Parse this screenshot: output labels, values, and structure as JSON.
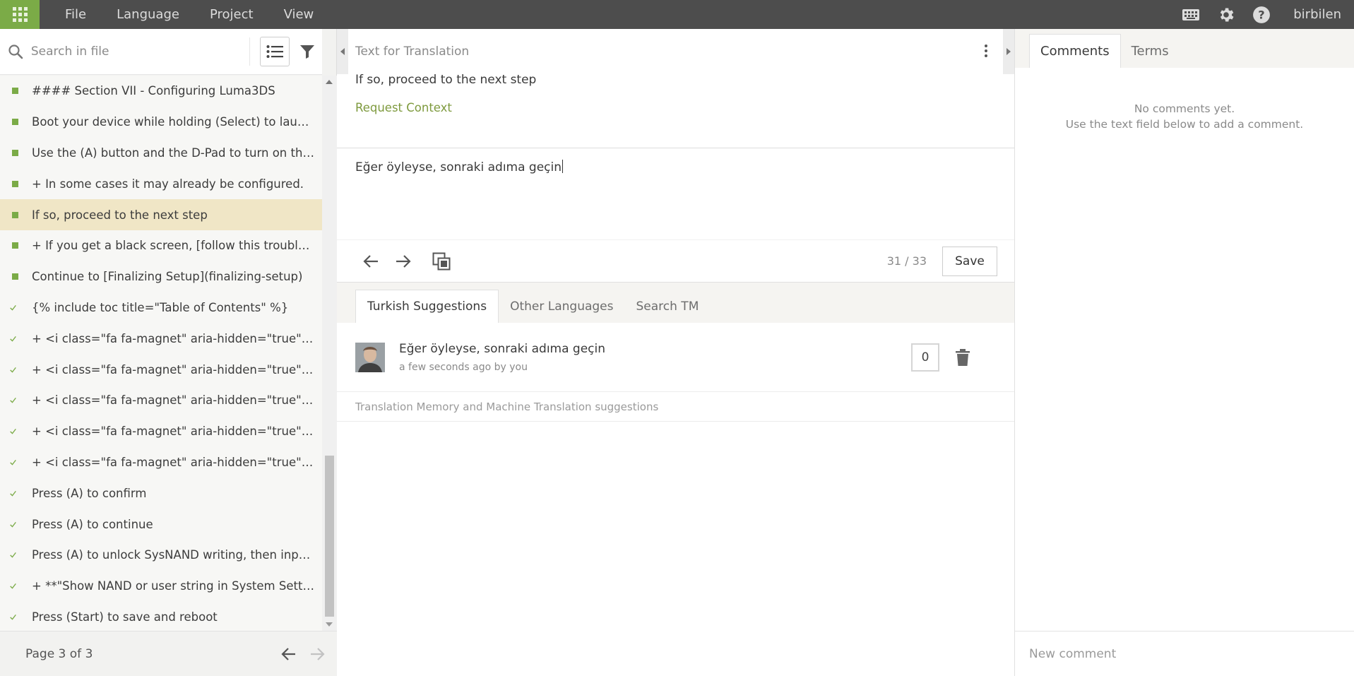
{
  "menu": [
    "File",
    "Language",
    "Project",
    "View"
  ],
  "user": {
    "name": "birbilen"
  },
  "search": {
    "placeholder": "Search in file"
  },
  "entities": [
    {
      "text": "#### Section VII - Configuring Luma3DS",
      "status": "translated-unreviewed"
    },
    {
      "text": "Boot your device while holding (Select) to launch t...",
      "status": "translated-unreviewed"
    },
    {
      "text": "Use the (A) button and the D-Pad to turn on the fol...",
      "status": "translated-unreviewed"
    },
    {
      "text": "+ In some cases it may already be configured.",
      "status": "translated-unreviewed"
    },
    {
      "text": "If so, proceed to the next step",
      "status": "translated-unreviewed",
      "active": true
    },
    {
      "text": "+ If you get a black screen, [follow this troubleshoo...",
      "status": "translated-unreviewed"
    },
    {
      "text": "Continue to [Finalizing Setup](finalizing-setup)",
      "status": "translated-unreviewed"
    },
    {
      "text": "{% include toc title=\"Table of Contents\" %}",
      "status": "approved"
    },
    {
      "text": "+ <i class=\"fa fa-magnet\" aria-hidden=\"true\" title=\"...",
      "status": "approved"
    },
    {
      "text": "+ <i class=\"fa fa-magnet\" aria-hidden=\"true\" title=\"...",
      "status": "approved"
    },
    {
      "text": "+ <i class=\"fa fa-magnet\" aria-hidden=\"true\" title=\"...",
      "status": "approved"
    },
    {
      "text": "+ <i class=\"fa fa-magnet\" aria-hidden=\"true\" title=\"...",
      "status": "approved"
    },
    {
      "text": "+ <i class=\"fa fa-magnet\" aria-hidden=\"true\" title=\"...",
      "status": "approved"
    },
    {
      "text": "Press (A) to confirm",
      "status": "approved"
    },
    {
      "text": "Press (A) to continue",
      "status": "approved"
    },
    {
      "text": "Press (A) to unlock SysNAND writing, then input th...",
      "status": "approved"
    },
    {
      "text": "+ **\"Show NAND or user string in System Settings...",
      "status": "approved"
    },
    {
      "text": "Press (Start) to save and reboot",
      "status": "approved"
    }
  ],
  "pager": {
    "text": "Page 3 of 3"
  },
  "editor": {
    "title": "Text for Translation",
    "source": "If so, proceed to the next step",
    "request_context": "Request Context",
    "translation": "Eğer öyleyse, sonraki adıma geçin",
    "counter": "31 / 33",
    "save_label": "Save"
  },
  "suggestion_tabs": [
    "Turkish Suggestions",
    "Other Languages",
    "Search TM"
  ],
  "suggestion": {
    "text": "Eğer öyleyse, sonraki adıma geçin",
    "meta": "a few seconds ago by you",
    "votes": "0"
  },
  "tm_label": "Translation Memory and Machine Translation suggestions",
  "right_tabs": [
    "Comments",
    "Terms"
  ],
  "comments": {
    "empty_line1": "No comments yet.",
    "empty_line2": "Use the text field below to add a comment.",
    "placeholder": "New comment"
  },
  "colors": {
    "accent": "#7bab47",
    "topbar": "#4d4d4d",
    "active_row": "#f0e6c6",
    "link": "#7e9a3e"
  }
}
